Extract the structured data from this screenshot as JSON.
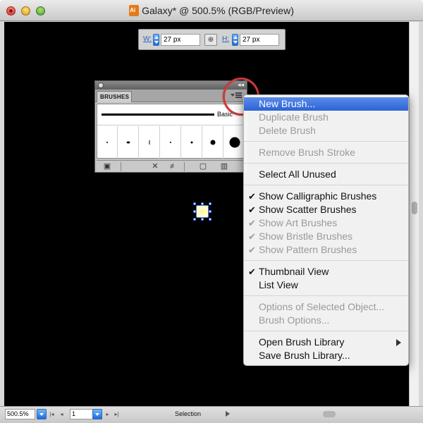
{
  "window": {
    "title": "Galaxy* @ 500.5% (RGB/Preview)",
    "app_icon": "illustrator-doc-icon"
  },
  "control_bar": {
    "width_label": "W:",
    "width_value": "27 px",
    "height_label": "H:",
    "height_value": "27 px",
    "link_icon": "constrain-link-icon"
  },
  "brushes_panel": {
    "tab_label": "BRUSHES",
    "basic_label": "Basic",
    "collapse_glyph": "◂◂",
    "footer_icons": [
      "brush-libraries-icon",
      "remove-stroke-icon",
      "options-icon",
      "new-brush-icon",
      "delete-brush-icon"
    ]
  },
  "menu": {
    "items": [
      {
        "label": "New Brush...",
        "state": "active",
        "checked": false
      },
      {
        "label": "Duplicate Brush",
        "state": "disabled",
        "checked": false
      },
      {
        "label": "Delete Brush",
        "state": "disabled",
        "checked": false
      },
      {
        "sep": true
      },
      {
        "label": "Remove Brush Stroke",
        "state": "disabled",
        "checked": false
      },
      {
        "sep": true
      },
      {
        "label": "Select All Unused",
        "state": "enabled",
        "checked": false
      },
      {
        "sep": true
      },
      {
        "label": "Show Calligraphic Brushes",
        "state": "enabled",
        "checked": true
      },
      {
        "label": "Show Scatter Brushes",
        "state": "enabled",
        "checked": true
      },
      {
        "label": "Show Art Brushes",
        "state": "disabled",
        "checked": true
      },
      {
        "label": "Show Bristle Brushes",
        "state": "disabled",
        "checked": true
      },
      {
        "label": "Show Pattern Brushes",
        "state": "disabled",
        "checked": true
      },
      {
        "sep": true
      },
      {
        "label": "Thumbnail View",
        "state": "enabled",
        "checked": true
      },
      {
        "label": "List View",
        "state": "enabled",
        "checked": false
      },
      {
        "sep": true
      },
      {
        "label": "Options of Selected Object...",
        "state": "disabled",
        "checked": false
      },
      {
        "label": "Brush Options...",
        "state": "disabled",
        "checked": false
      },
      {
        "sep": true
      },
      {
        "label": "Open Brush Library",
        "state": "enabled",
        "checked": false,
        "submenu": true
      },
      {
        "label": "Save Brush Library...",
        "state": "enabled",
        "checked": false
      }
    ]
  },
  "status_bar": {
    "zoom": "500.5%",
    "page": "1",
    "tool": "Selection"
  },
  "colors": {
    "canvas": "#000000",
    "menu_highlight": "#2c63d6",
    "highlight_ring": "#cc3b3b",
    "selection_handle": "#2c54d6"
  }
}
